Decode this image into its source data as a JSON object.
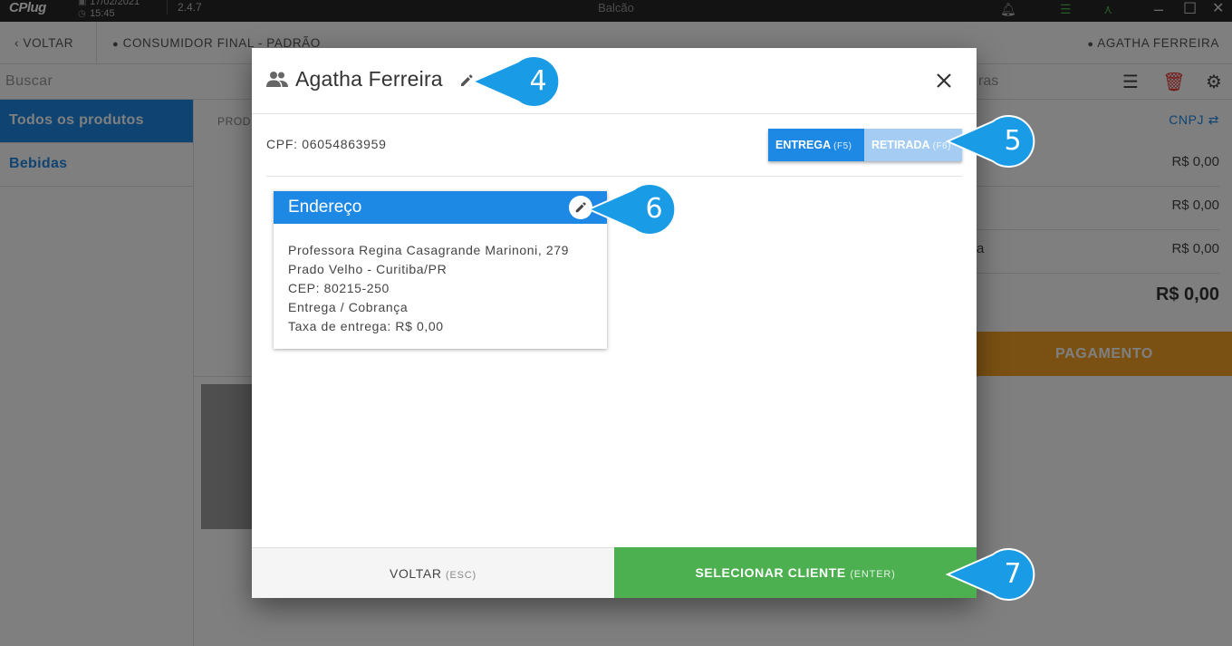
{
  "titlebar": {
    "logo": "CPlug",
    "date": "17/02/2021",
    "time": "15:45",
    "version": "2.4.7",
    "title": "Balcão"
  },
  "topnav": {
    "back_label": "VOLTAR",
    "customer_label": "CONSUMIDOR FINAL - PADRÃO",
    "user_label": "AGATHA FERREIRA"
  },
  "search": {
    "placeholder": "Buscar",
    "cart_placeholder_fragment": "ras"
  },
  "sidebar": {
    "items": [
      {
        "label": "Todos os produtos",
        "active": true
      },
      {
        "label": "Bebidas",
        "active": false
      }
    ]
  },
  "products": {
    "header_fragment": "PROD"
  },
  "cart": {
    "document_toggle": "CNPJ",
    "rows": [
      {
        "label": "",
        "value": "R$ 0,00"
      },
      {
        "label": "",
        "value": "R$ 0,00"
      },
      {
        "label": "a",
        "value": "R$ 0,00"
      }
    ],
    "total": "R$ 0,00",
    "payment_button": "PAGAMENTO",
    "colors": {
      "payment": "#f7a326"
    }
  },
  "dialog": {
    "title": "Agatha Ferreira",
    "cpf": "CPF: 06054863959",
    "delivery_button": {
      "label": "ENTREGA",
      "shortcut": "(F5)",
      "selected": true
    },
    "pickup_button": {
      "label": "RETIRADA",
      "shortcut": "(F6)",
      "selected": false
    },
    "address_card": {
      "title": "Endereço",
      "lines": [
        "Professora Regina Casagrande Marinoni, 279",
        "Prado Velho - Curitiba/PR",
        "CEP: 80215-250",
        "Entrega / Cobrança",
        "Taxa de entrega: R$ 0,00"
      ]
    },
    "back_button": {
      "label": "VOLTAR",
      "shortcut": "(ESC)"
    },
    "select_button": {
      "label": "SELECIONAR CLIENTE",
      "shortcut": "(ENTER)"
    },
    "colors": {
      "primary": "#1e88e5",
      "confirm": "#4caf50"
    }
  },
  "callouts": [
    "4",
    "5",
    "6",
    "7"
  ]
}
